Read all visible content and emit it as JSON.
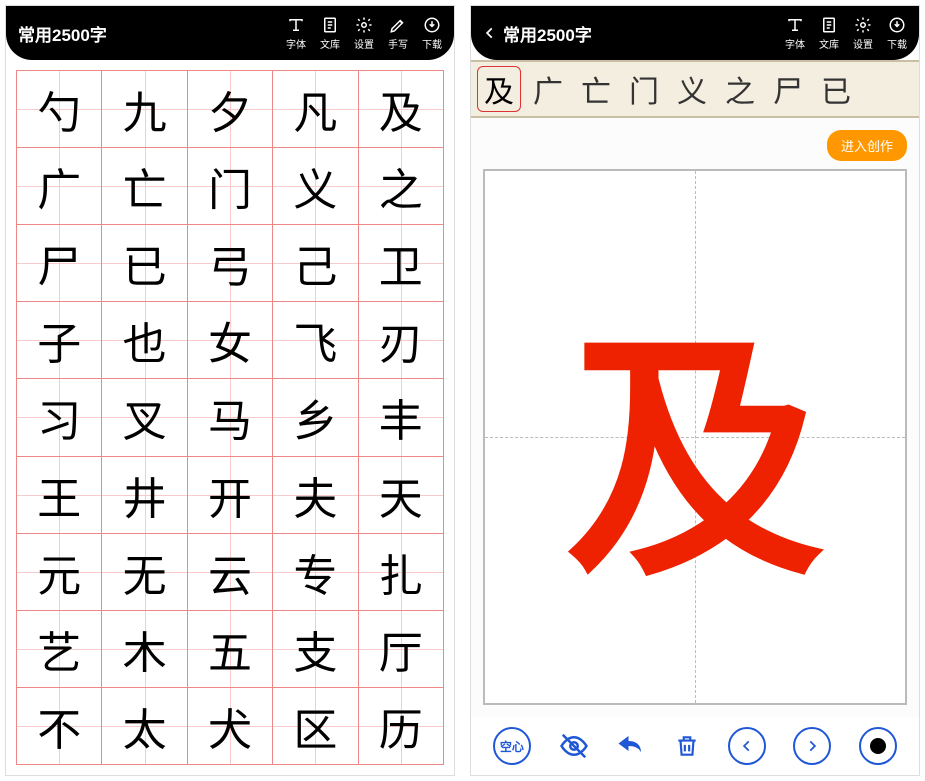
{
  "left": {
    "title": "常用2500字",
    "tools": [
      "字体",
      "文库",
      "设置",
      "手写",
      "下载"
    ],
    "chars": [
      "勺",
      "九",
      "夕",
      "凡",
      "及",
      "广",
      "亡",
      "门",
      "义",
      "之",
      "尸",
      "已",
      "弓",
      "己",
      "卫",
      "子",
      "也",
      "女",
      "飞",
      "刃",
      "习",
      "叉",
      "马",
      "乡",
      "丰",
      "王",
      "井",
      "开",
      "夫",
      "天",
      "元",
      "无",
      "云",
      "专",
      "扎",
      "艺",
      "木",
      "五",
      "支",
      "厅",
      "不",
      "太",
      "犬",
      "区",
      "历"
    ]
  },
  "right": {
    "title": "常用2500字",
    "tools": [
      "字体",
      "文库",
      "设置",
      "下载"
    ],
    "strip": [
      "及",
      "广",
      "亡",
      "门",
      "义",
      "之",
      "尸",
      "已"
    ],
    "create": "进入创作",
    "bigchar": "及",
    "hollow": "空心"
  }
}
